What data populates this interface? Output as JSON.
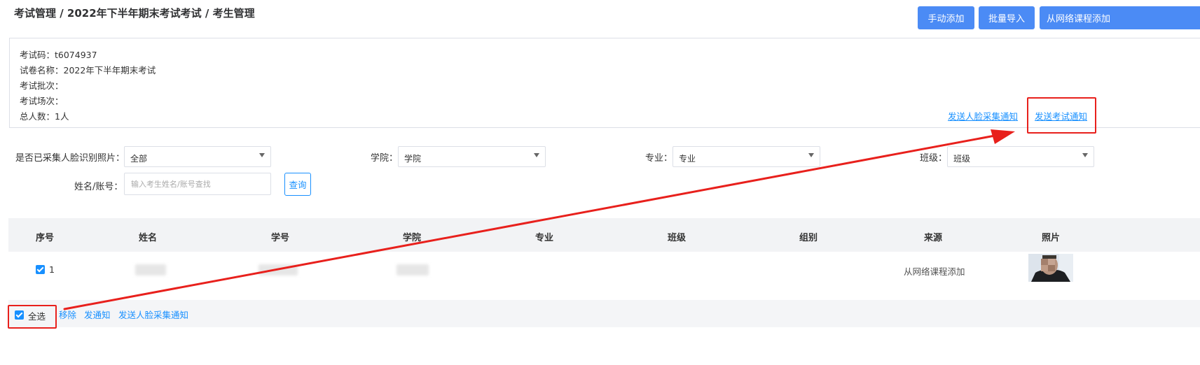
{
  "header": {
    "breadcrumb": "考试管理 / 2022年下半年期末考试考试 / 考生管理",
    "buttons": {
      "manual_add": "手动添加",
      "batch_import": "批量导入",
      "from_course": "从网络课程添加"
    }
  },
  "info": {
    "exam_code": "考试码：t6074937",
    "paper_name": "试卷名称：2022年下半年期末考试",
    "batch": "考试批次：",
    "session": "考试场次：",
    "total": "总人数：1人",
    "send_face_notice": "发送人脸采集通知",
    "send_exam_notice": "发送考试通知"
  },
  "filters": {
    "face_label": "是否已采集人脸识别照片：",
    "face_value": "全部",
    "college_label": "学院：",
    "college_value": "学院",
    "major_label": "专业：",
    "major_value": "专业",
    "class_label": "班级：",
    "class_value": "班级",
    "name_label": "姓名/账号：",
    "name_placeholder": "输入考生姓名/账号查找",
    "query_button": "查询"
  },
  "table": {
    "columns": [
      "序号",
      "姓名",
      "学号",
      "学院",
      "专业",
      "班级",
      "组别",
      "来源",
      "照片"
    ],
    "rows": [
      {
        "index": "1",
        "name": "",
        "student_id": "",
        "college": "",
        "major": "",
        "class": "",
        "group": "",
        "source": "从网络课程添加",
        "checked": true
      }
    ]
  },
  "footer": {
    "select_all": "全选",
    "remove": "移除",
    "send_notice": "发通知",
    "send_face_notice": "发送人脸采集通知"
  },
  "colors": {
    "primary": "#4b8bf5",
    "link": "#1890ff",
    "annotation_red": "#e8201c",
    "table_header_bg": "#f2f3f5"
  }
}
